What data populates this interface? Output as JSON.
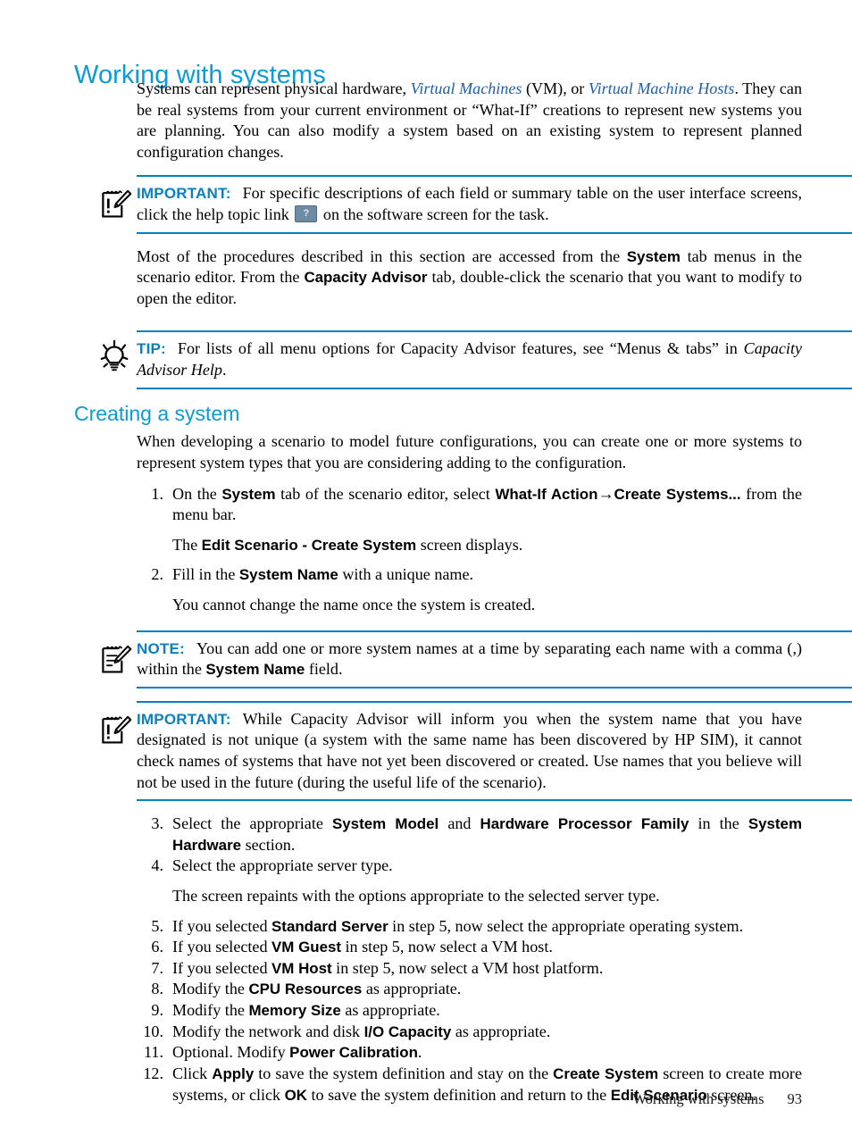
{
  "page": {
    "title": "Working with systems",
    "footer_text": "Working with systems",
    "page_number": "93",
    "accent_color": "#0b9bd6",
    "rule_color": "#0081c2",
    "link_color": "#1f5fa8"
  },
  "intro": {
    "p1_a": "Systems can represent physical hardware, ",
    "p1_link1": "Virtual Machines",
    "p1_b": " (VM), or ",
    "p1_link2": "Virtual Machine Hosts",
    "p1_c": ". They can be real systems from your current environment or “What-If” creations to represent new systems you are planning. You can also modify a system based on an existing system to represent planned configuration changes."
  },
  "important1": {
    "label": "IMPORTANT:",
    "icon": "important-notepad-icon",
    "text_a": "For specific descriptions of each field or summary table on the user interface screens, click the help topic link ",
    "help_icon_glyph": "?",
    "help_icon_name": "help-topic-link-icon",
    "text_b": " on the software screen for the task."
  },
  "para2": {
    "a": "Most of the procedures described in this section are accessed from the ",
    "b1": "System",
    "b": " tab menus in the scenario editor. From the ",
    "b2": "Capacity Advisor",
    "c": " tab, double-click the scenario that you want to modify to open the editor."
  },
  "tip": {
    "label": "TIP:",
    "icon": "lightbulb-tip-icon",
    "text_a": "For lists of all menu options for Capacity Advisor features, see “Menus & tabs” in ",
    "italic": "Capacity Advisor Help",
    "text_b": "."
  },
  "section": {
    "heading": "Creating a system",
    "intro": "When developing a scenario to model future configurations, you can create one or more systems to represent system types that you are considering adding to the configuration."
  },
  "steps": [
    {
      "num": "1.",
      "parts": [
        "On the ",
        "System",
        " tab of the scenario editor, select ",
        "What-If Action",
        "→",
        "Create Systems...",
        " from the menu bar."
      ],
      "sub_a": "The ",
      "sub_b": "Edit Scenario - Create System",
      "sub_c": " screen displays."
    },
    {
      "num": "2.",
      "a": "Fill in the ",
      "b": "System Name",
      "c": " with a unique name.",
      "sub": "You cannot change the name once the system is created."
    },
    {
      "num": "3.",
      "a": "Select the appropriate ",
      "b1": "System Model",
      "b": " and ",
      "b2": "Hardware Processor Family",
      "c": " in the ",
      "b3": "System Hardware",
      "d": " section."
    },
    {
      "num": "4.",
      "a": "Select the appropriate server type.",
      "sub": "The screen repaints with the options appropriate to the selected server type."
    },
    {
      "num": "5.",
      "a": "If you selected ",
      "b": "Standard Server",
      "c": " in step 5, now select the appropriate operating system."
    },
    {
      "num": "6.",
      "a": "If you selected ",
      "b": "VM Guest",
      "c": " in step 5, now select a VM host."
    },
    {
      "num": "7.",
      "a": "If you selected ",
      "b": "VM Host",
      "c": " in step 5, now select a VM host platform."
    },
    {
      "num": "8.",
      "a": "Modify the ",
      "b": "CPU Resources",
      "c": " as appropriate."
    },
    {
      "num": "9.",
      "a": "Modify the ",
      "b": "Memory Size",
      "c": " as appropriate."
    },
    {
      "num": "10.",
      "a": "Modify the network and disk ",
      "b": "I/O Capacity",
      "c": " as appropriate."
    },
    {
      "num": "11.",
      "a": "Optional. Modify ",
      "b": "Power Calibration",
      "c": "."
    },
    {
      "num": "12.",
      "a": "Click ",
      "b1": "Apply",
      "b": " to save the system definition and stay on the ",
      "b2": "Create System",
      "c": " screen to create more systems, or click ",
      "b3": "OK",
      "d": " to save the system definition and return to the ",
      "b4": "Edit Scenario",
      "e": " screen."
    }
  ],
  "note": {
    "label": "NOTE:",
    "icon": "note-notepad-icon",
    "text_a": "You can add one or more system names at a time by separating each name with a comma (,) within the ",
    "bold": "System Name",
    "text_b": " field."
  },
  "important2": {
    "label": "IMPORTANT:",
    "icon": "important-notepad-icon",
    "text": "While Capacity Advisor will inform you when the system name that you have designated is not unique (a system with the same name has been discovered by HP SIM), it cannot check names of systems that have not yet been discovered or created. Use names that you believe will not be used in the future (during the useful life of the scenario)."
  }
}
